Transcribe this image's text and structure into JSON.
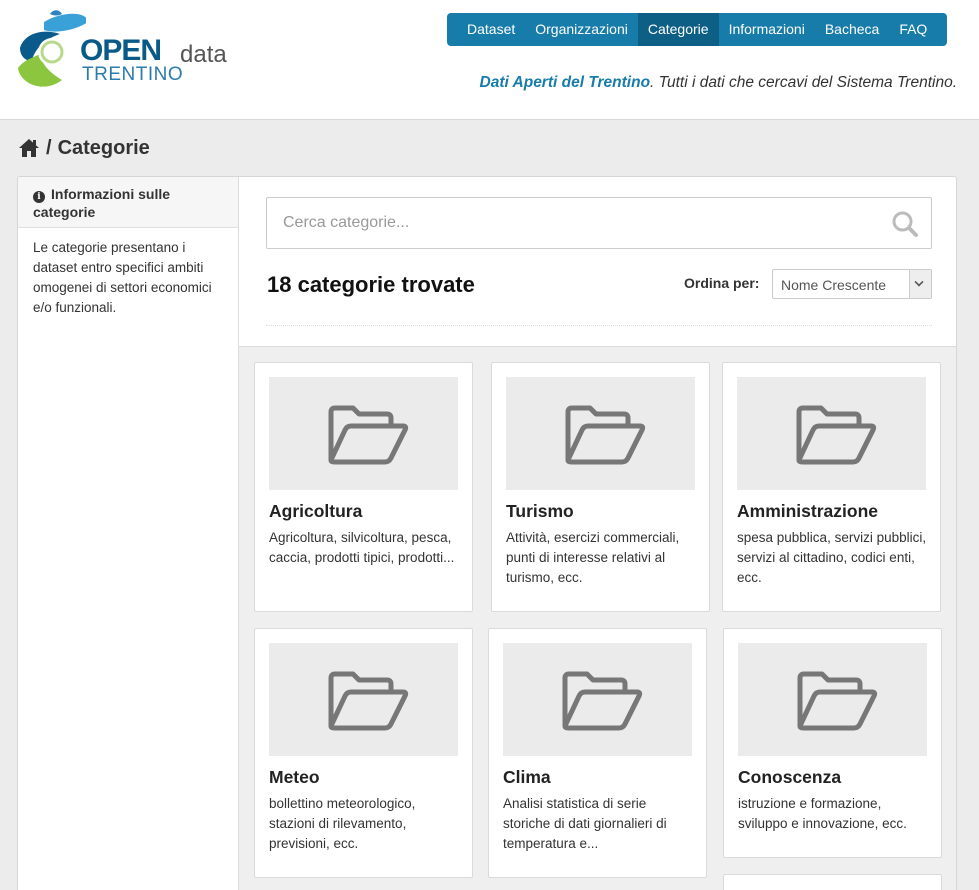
{
  "header": {
    "logo_open": "OPEN",
    "logo_data": "data",
    "logo_trentino": "TRENTINO",
    "nav": [
      {
        "label": "Dataset",
        "active": false
      },
      {
        "label": "Organizzazioni",
        "active": false
      },
      {
        "label": "Categorie",
        "active": true
      },
      {
        "label": "Informazioni",
        "active": false
      },
      {
        "label": "Bacheca",
        "active": false
      },
      {
        "label": "FAQ",
        "active": false
      }
    ],
    "tagline_bold": "Dati Aperti del Trentino",
    "tagline_rest": ". Tutti i dati che cercavi del Sistema Trentino."
  },
  "breadcrumb": {
    "separator": "/",
    "current": "Categorie"
  },
  "sidebar": {
    "heading": "Informazioni sulle categorie",
    "body": "Le categorie presentano i dataset entro specifici ambiti omogenei di settori economici e/o funzionali."
  },
  "search": {
    "placeholder": "Cerca categorie..."
  },
  "results": {
    "title": "18 categorie trovate",
    "order_label": "Ordina per:",
    "order_value": "Nome Crescente"
  },
  "categories": [
    {
      "title": "Agricoltura",
      "description": "Agricoltura, silvicoltura, pesca, caccia, prodotti tipici, prodotti..."
    },
    {
      "title": "Turismo",
      "description": "Attività, esercizi commerciali, punti di interesse relativi al turismo, ecc."
    },
    {
      "title": "Amministrazione",
      "description": "spesa pubblica, servizi pubblici, servizi al cittadino, codici enti, ecc."
    },
    {
      "title": "Meteo",
      "description": "bollettino meteorologico, stazioni di rilevamento, previsioni, ecc."
    },
    {
      "title": "Clima",
      "description": "Analisi statistica di serie storiche di dati giornalieri di temperatura e..."
    },
    {
      "title": "Conoscenza",
      "description": "istruzione e formazione, sviluppo e innovazione, ecc."
    }
  ],
  "colors": {
    "nav_bg": "#187caa",
    "nav_active": "#0e5f86",
    "brand_blue": "#187caa",
    "page_bg": "#ececec"
  }
}
